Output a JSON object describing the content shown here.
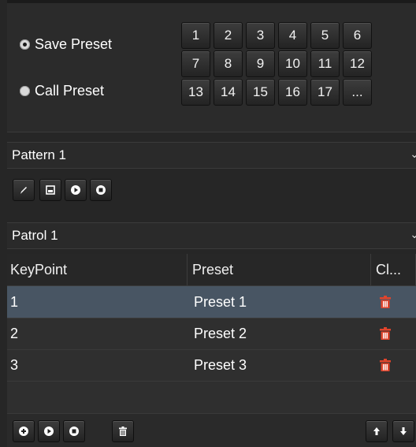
{
  "preset": {
    "save_label": "Save Preset",
    "call_label": "Call Preset",
    "selected": "save",
    "buttons": [
      "1",
      "2",
      "3",
      "4",
      "5",
      "6",
      "7",
      "8",
      "9",
      "10",
      "11",
      "12",
      "13",
      "14",
      "15",
      "16",
      "17",
      "..."
    ]
  },
  "pattern": {
    "value": "Pattern 1",
    "icons": [
      "pencil-icon",
      "save-icon",
      "play-icon",
      "stop-icon"
    ]
  },
  "patrol": {
    "value": "Patrol 1",
    "columns": [
      "KeyPoint",
      "Preset",
      "Cl..."
    ],
    "rows": [
      {
        "keypoint": "1",
        "preset": "Preset 1",
        "selected": true
      },
      {
        "keypoint": "2",
        "preset": "Preset 2",
        "selected": false
      },
      {
        "keypoint": "3",
        "preset": "Preset 3",
        "selected": false
      }
    ],
    "footer_icons": [
      "add-icon",
      "play-icon",
      "stop-icon",
      "trash-icon",
      "arrow-up-icon",
      "arrow-down-icon"
    ]
  },
  "colors": {
    "accent_delete": "#e0442c",
    "selected_row": "#485563"
  }
}
